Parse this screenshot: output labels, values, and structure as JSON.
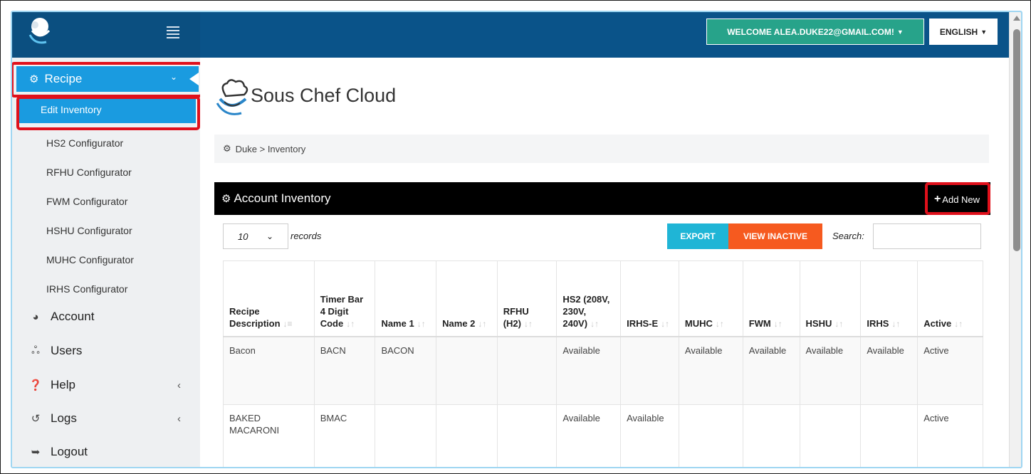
{
  "topbar": {
    "welcome": "WELCOME ALEA.DUKE22@GMAIL.COM!",
    "language": "ENGLISH"
  },
  "sidebar": {
    "recipe": "Recipe",
    "active_sub": "Edit Inventory",
    "subitems": [
      "HS2 Configurator",
      "RFHU Configurator",
      "FWM Configurator",
      "HSHU Configurator",
      "MUHC Configurator",
      "IRHS Configurator"
    ],
    "items": [
      "Account",
      "Users",
      "Help",
      "Logs",
      "Logout"
    ]
  },
  "main": {
    "site_title": "Sous Chef Cloud",
    "breadcrumb": "Duke > Inventory",
    "panel_title": "Account Inventory",
    "add_new": "Add New",
    "records_value": "10",
    "records_label": "records",
    "export": "EXPORT",
    "view_inactive": "VIEW INACTIVE",
    "search_label": "Search:"
  },
  "table": {
    "headers": [
      "Recipe Description",
      "Timer Bar 4 Digit Code",
      "Name 1",
      "Name 2",
      "RFHU (H2)",
      "HS2 (208V, 230V, 240V)",
      "IRHS-E",
      "MUHC",
      "FWM",
      "HSHU",
      "IRHS",
      "Active"
    ],
    "rows": [
      [
        "Bacon",
        "BACN",
        "BACON",
        "",
        "",
        "Available",
        "",
        "Available",
        "Available",
        "Available",
        "Available",
        "Active"
      ],
      [
        "BAKED MACARONI",
        "BMAC",
        "",
        "",
        "",
        "Available",
        "Available",
        "",
        "",
        "",
        "",
        "Active"
      ]
    ]
  },
  "colors": {
    "topbar": "#0a5389",
    "accent": "#1a9be0",
    "welcome": "#27a38a",
    "export": "#1fb5d6",
    "inactive": "#f65a1f",
    "highlight": "#e0101b"
  }
}
